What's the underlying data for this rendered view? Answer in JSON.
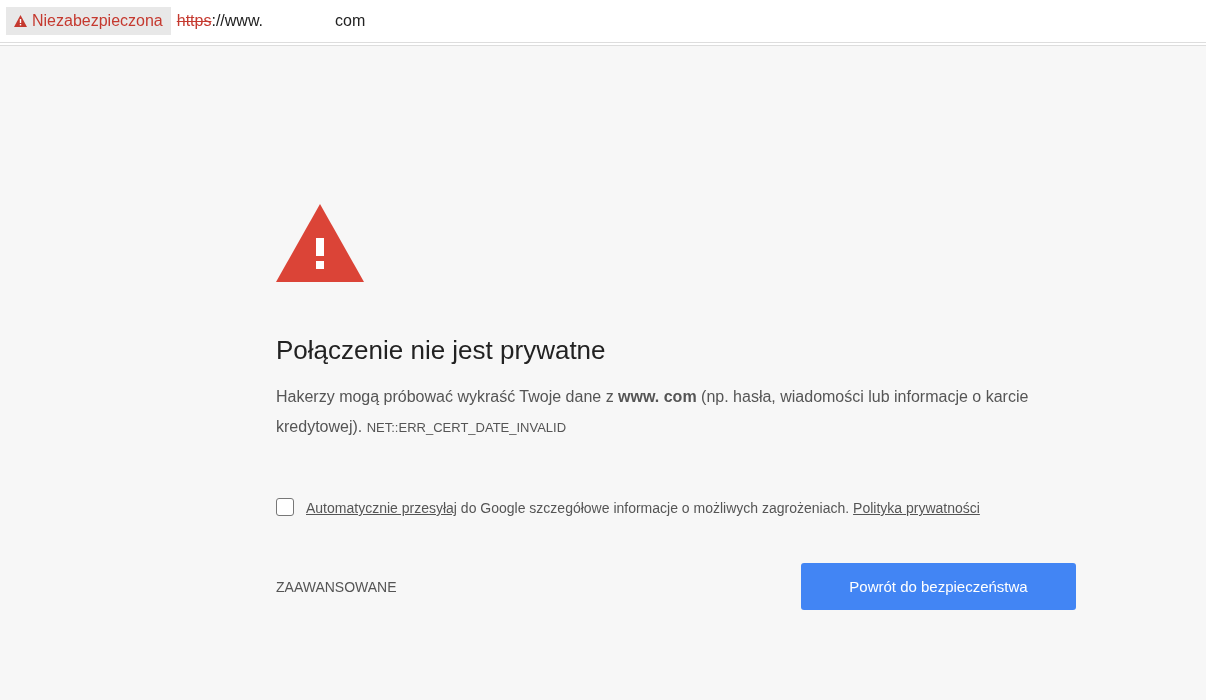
{
  "address_bar": {
    "security_label": "Niezabezpieczona",
    "scheme": "https",
    "scheme_struck": true,
    "host_start": "://www.",
    "host_end": "com"
  },
  "interstitial": {
    "heading": "Połączenie nie jest prywatne",
    "description": "Hakerzy mogą próbować wykraść Twoje dane z **www.** **com** (np. hasła, wiadomości lub informacje o karcie kredytowej).",
    "error_code": "NET::ERR_CERT_DATE_INVALID",
    "report": {
      "checked": false,
      "link": "Automatycznie przesyłaj",
      "text": "do Google szczegółowe informacje o możliwych zagrożeniach.",
      "policy_link": "Polityka prywatności"
    },
    "advanced_button": "ZAAWANSOWANE",
    "back_button": "Powrót do bezpieczeństwa"
  }
}
